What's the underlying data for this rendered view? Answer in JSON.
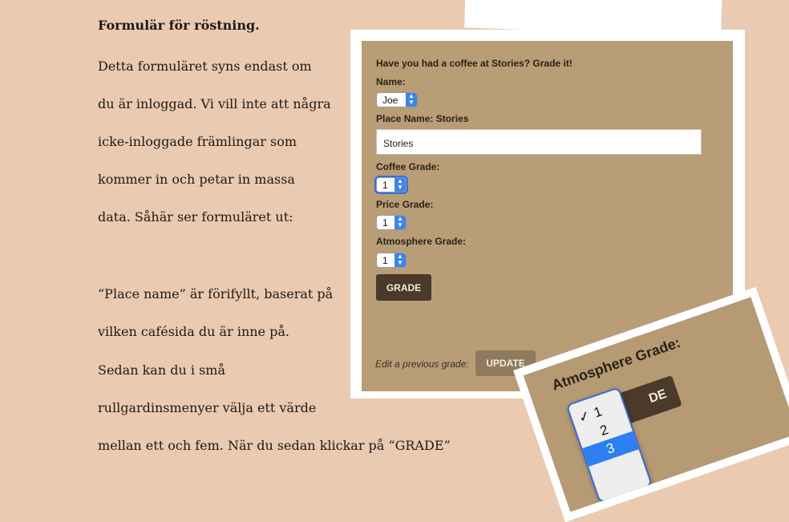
{
  "document": {
    "heading": "Formulär för röstning.",
    "lines": [
      "Detta formuläret syns endast om",
      "du är inloggad. Vi vill inte att några",
      "icke-inloggade främlingar som",
      "kommer in och petar in massa",
      "data. Såhär ser formuläret ut:",
      "“Place name” är förifyllt, baserat på",
      "vilken cafésida du är inne på.",
      "Sedan kan du i små",
      "rullgardinsmenyer välja ett värde",
      "mellan ett och fem. När du sedan klickar på “GRADE”"
    ]
  },
  "form": {
    "title": "Have you had a coffee at Stories? Grade it!",
    "name_label": "Name:",
    "name_value": "Joe",
    "place_label": "Place Name: Stories",
    "place_value": "Stories",
    "coffee_label": "Coffee Grade:",
    "coffee_value": "1",
    "price_label": "Price Grade:",
    "price_value": "1",
    "atmosphere_label": "Atmosphere Grade:",
    "atmosphere_value": "1",
    "grade_button": "GRADE",
    "edit_label": "Edit a previous grade:",
    "update_button": "UPDATE"
  },
  "inset": {
    "title": "Atmosphere Grade:",
    "options": [
      "1",
      "2",
      "3"
    ],
    "checkmark": "✓",
    "button_fragment": "DE"
  },
  "colors": {
    "page_background": "#eacab0",
    "panel_background": "#b89d76",
    "button_dark": "#4b3a2a",
    "select_accent": "#3d85e8"
  }
}
